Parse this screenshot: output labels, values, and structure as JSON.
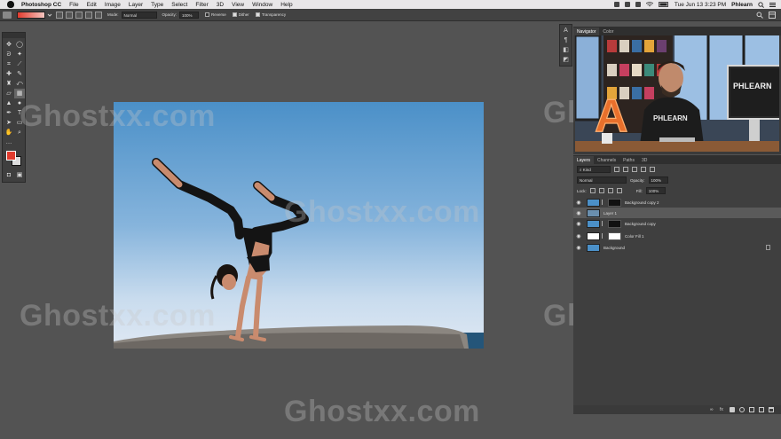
{
  "menubar": {
    "app_name": "Photoshop CC",
    "items": [
      "File",
      "Edit",
      "Image",
      "Layer",
      "Type",
      "Select",
      "Filter",
      "3D",
      "View",
      "Window",
      "Help"
    ],
    "clock": "Tue Jun 13  3:23 PM",
    "user": "Phlearn"
  },
  "options": {
    "mode_label": "Mode:",
    "mode_value": "Normal",
    "opacity_label": "Opacity:",
    "opacity_value": "100%",
    "reverse_label": "Reverse",
    "dither_label": "Dither",
    "transparency_label": "Transparency"
  },
  "colors": {
    "foreground": "#e23b2e",
    "background": "#dddddd",
    "accent": "#4b90c8"
  },
  "watermark": "Ghostxx.com",
  "navigator": {
    "tabs": [
      "Navigator",
      "Color"
    ],
    "screen_label": "PHLEARN",
    "shirt_label": "PHLEARN",
    "sign_letter": "A"
  },
  "layers": {
    "tabs": [
      "Layers",
      "Channels",
      "Paths",
      "3D"
    ],
    "filter_label": "Kind",
    "blend_mode": "Normal",
    "opacity_label": "Opacity:",
    "opacity_value": "100%",
    "lock_label": "Lock:",
    "fill_label": "Fill:",
    "fill_value": "100%",
    "items": [
      {
        "name": "Background copy 2"
      },
      {
        "name": "Layer 1"
      },
      {
        "name": "Background copy"
      },
      {
        "name": "Color Fill 1"
      },
      {
        "name": "Background"
      }
    ]
  }
}
